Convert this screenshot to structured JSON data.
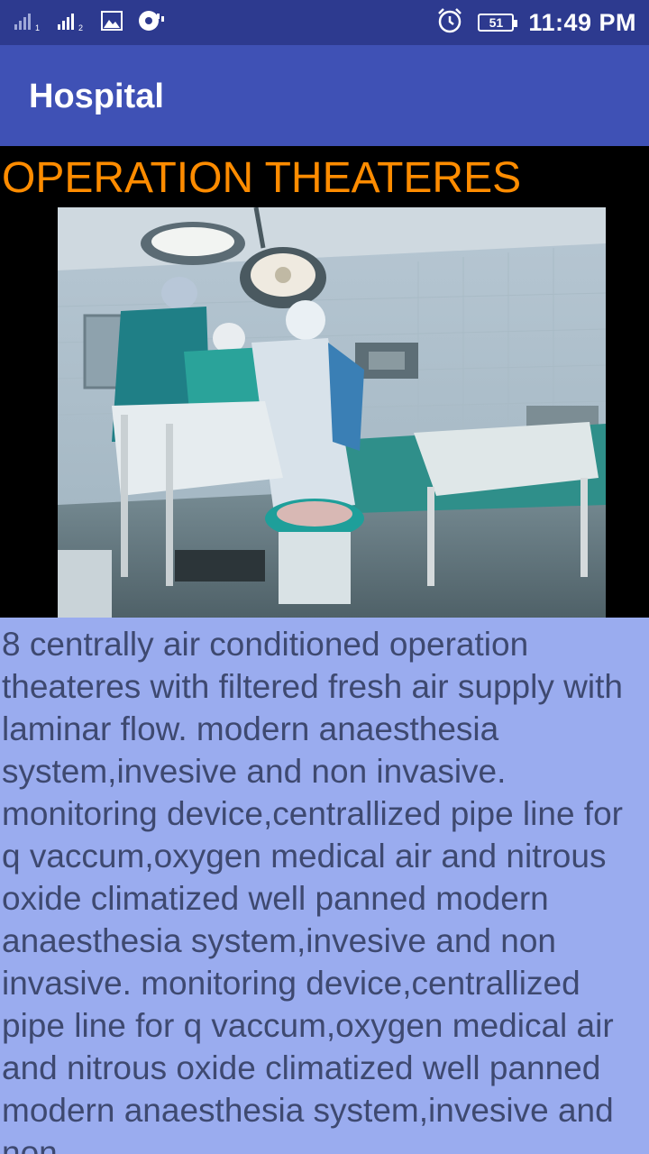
{
  "status_bar": {
    "time": "11:49 PM",
    "battery": "51",
    "sim1_label": "1",
    "sim2_label": "2"
  },
  "app_bar": {
    "title": "Hospital"
  },
  "section": {
    "title": "OPERATION THEATERES",
    "description": "8 centrally air conditioned operation theateres with filtered fresh air supply with laminar flow. modern anaesthesia system,invesive and non invasive. monitoring device,centrallized pipe line for q vaccum,oxygen medical air and nitrous oxide climatized well panned modern anaesthesia system,invesive and non invasive. monitoring device,centrallized pipe line for q vaccum,oxygen medical air and nitrous oxide climatized well panned modern anaesthesia system,invesive and non"
  },
  "colors": {
    "status_bar": "#2d3a8f",
    "app_bar": "#3f51b5",
    "title_text": "#ff8c00",
    "description_bg": "#9aacef",
    "description_text": "#3e4970"
  }
}
